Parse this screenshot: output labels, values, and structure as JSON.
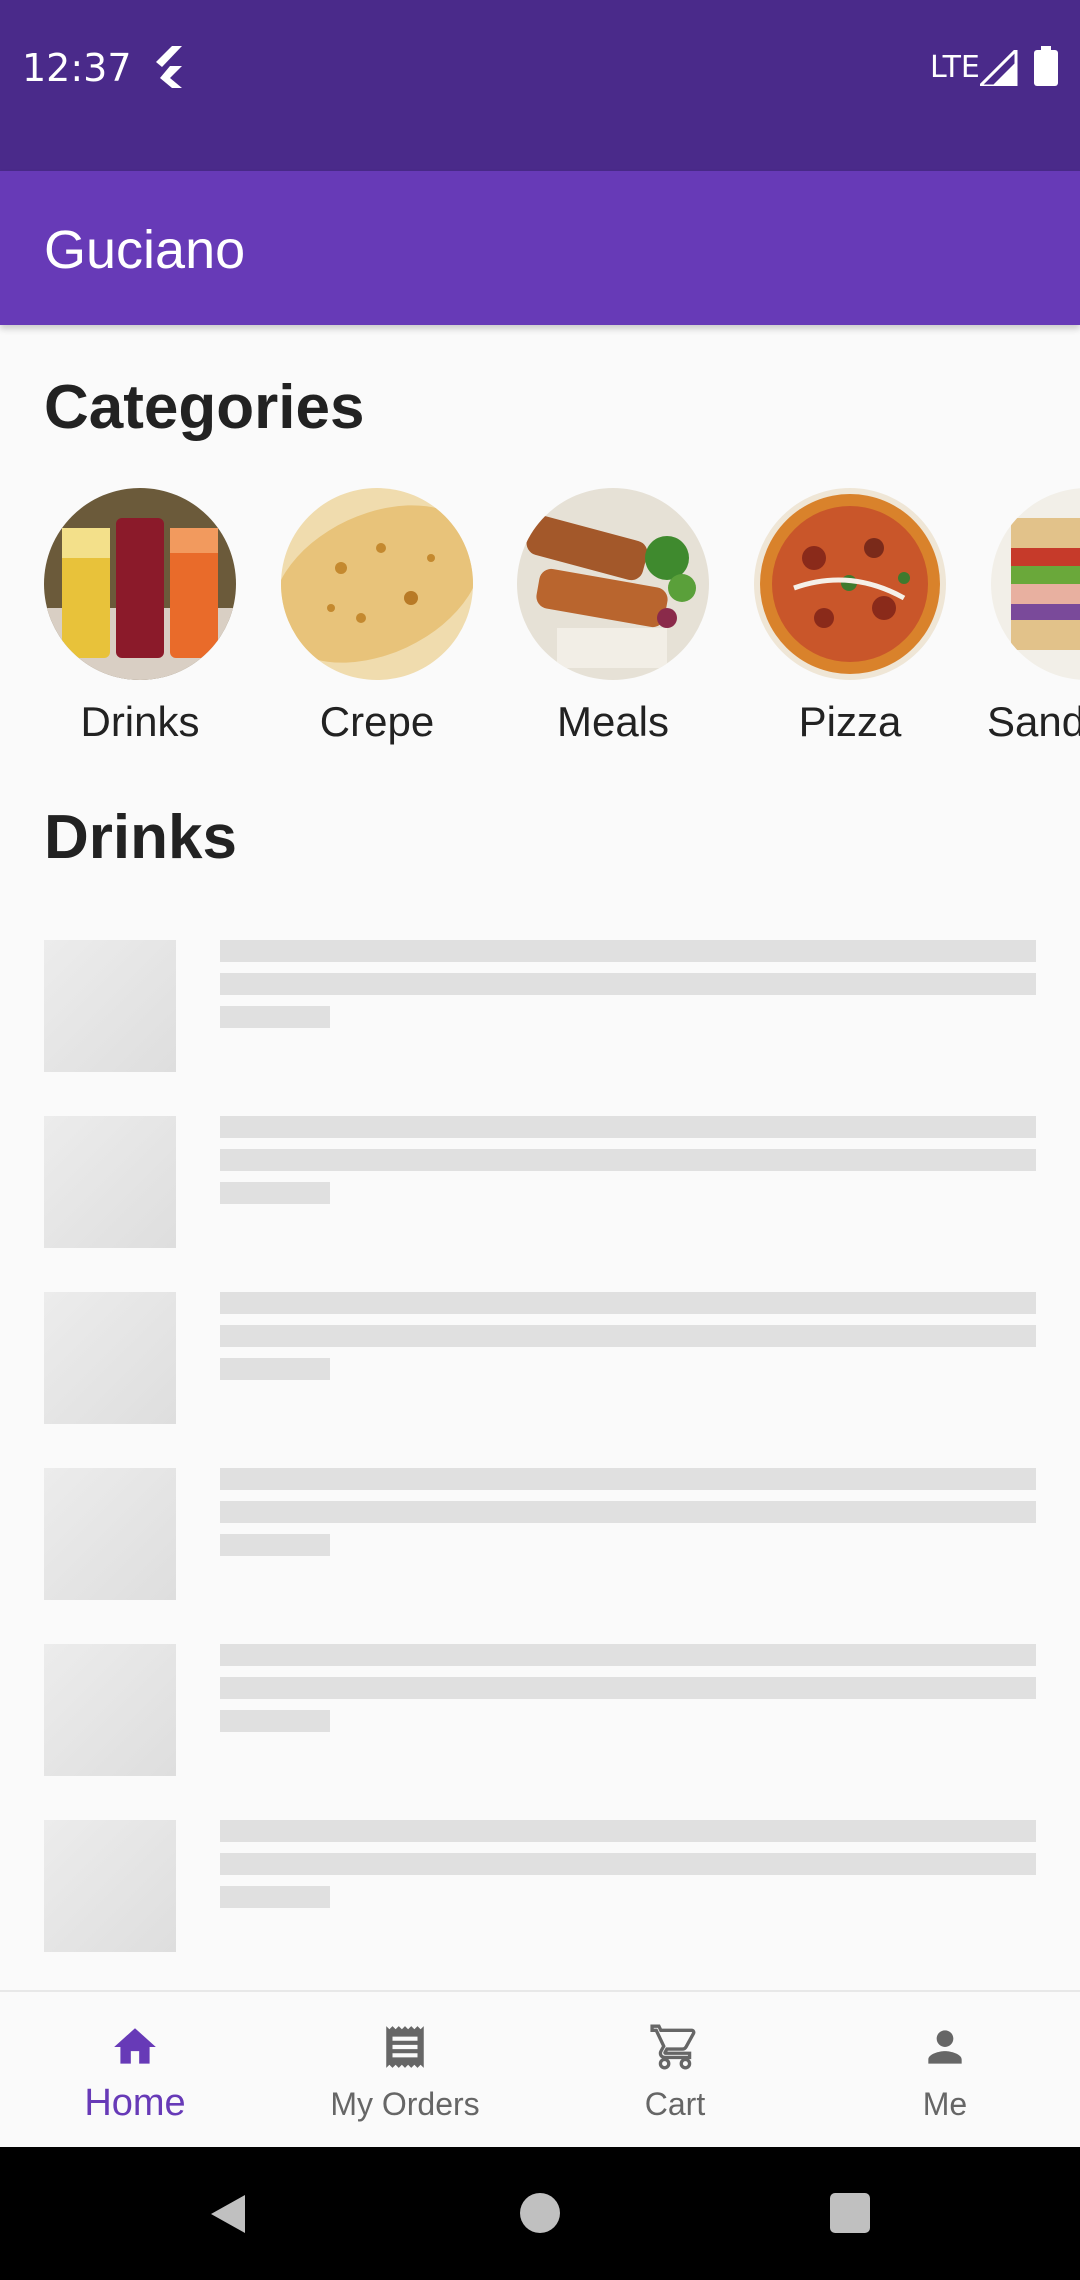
{
  "status_bar": {
    "time": "12:37",
    "network": "LTE"
  },
  "app_bar": {
    "title": "Guciano"
  },
  "categories_title": "Categories",
  "categories": [
    {
      "label": "Drinks"
    },
    {
      "label": "Crepe"
    },
    {
      "label": "Meals"
    },
    {
      "label": "Pizza"
    },
    {
      "label": "Sandwiches"
    }
  ],
  "current_section_title": "Drinks",
  "bottom_nav": {
    "items": [
      {
        "label": "Home",
        "icon": "home-icon",
        "active": true
      },
      {
        "label": "My Orders",
        "icon": "receipt-icon",
        "active": false
      },
      {
        "label": "Cart",
        "icon": "cart-icon",
        "active": false
      },
      {
        "label": "Me",
        "icon": "person-icon",
        "active": false
      }
    ]
  },
  "colors": {
    "status_bar": "#4a2a8a",
    "primary": "#673ab7",
    "background": "#fafafa",
    "skeleton": "#e0e0e0"
  }
}
